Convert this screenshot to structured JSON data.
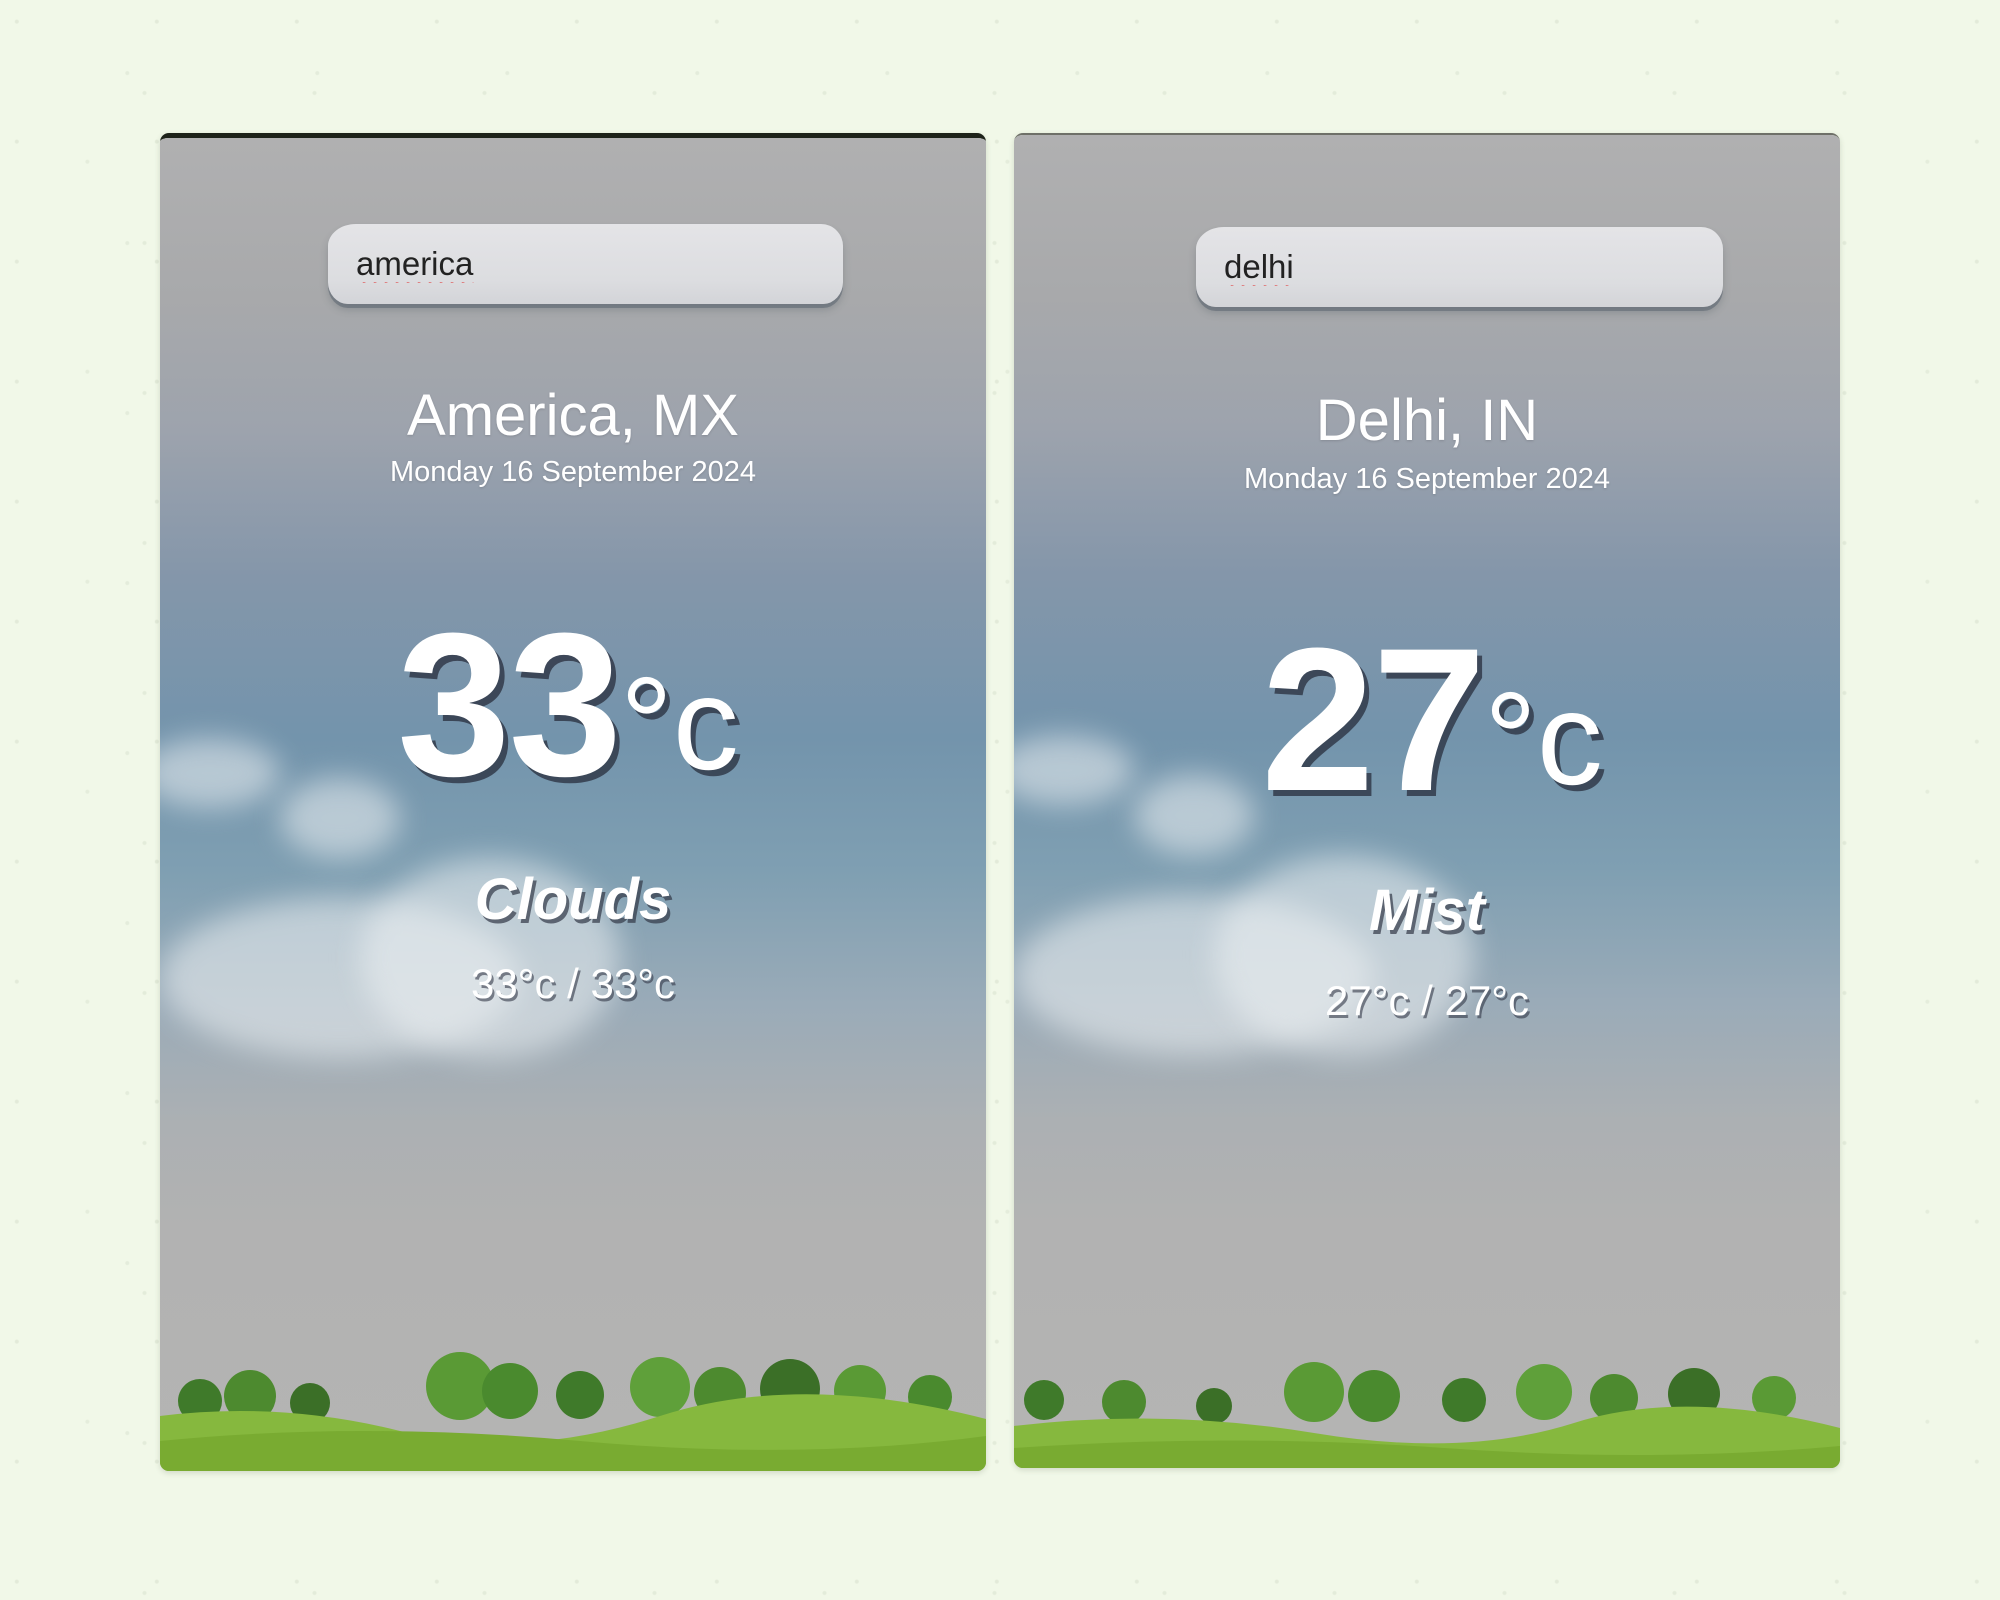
{
  "cards": [
    {
      "search_value": "america",
      "location": "America, MX",
      "date": "Monday 16 September 2024",
      "temp_value": "33",
      "temp_unit": "°c",
      "condition": "Clouds",
      "temp_range": "33°c / 33°c"
    },
    {
      "search_value": "delhi",
      "location": "Delhi, IN",
      "date": "Monday 16 September 2024",
      "temp_value": "27",
      "temp_unit": "°c",
      "condition": "Mist",
      "temp_range": "27°c / 27°c"
    }
  ],
  "colors": {
    "page_background": "#f1f8e8",
    "text": "#ffffff",
    "search_background": "#dcdde0",
    "grass": "#7fb33a"
  }
}
